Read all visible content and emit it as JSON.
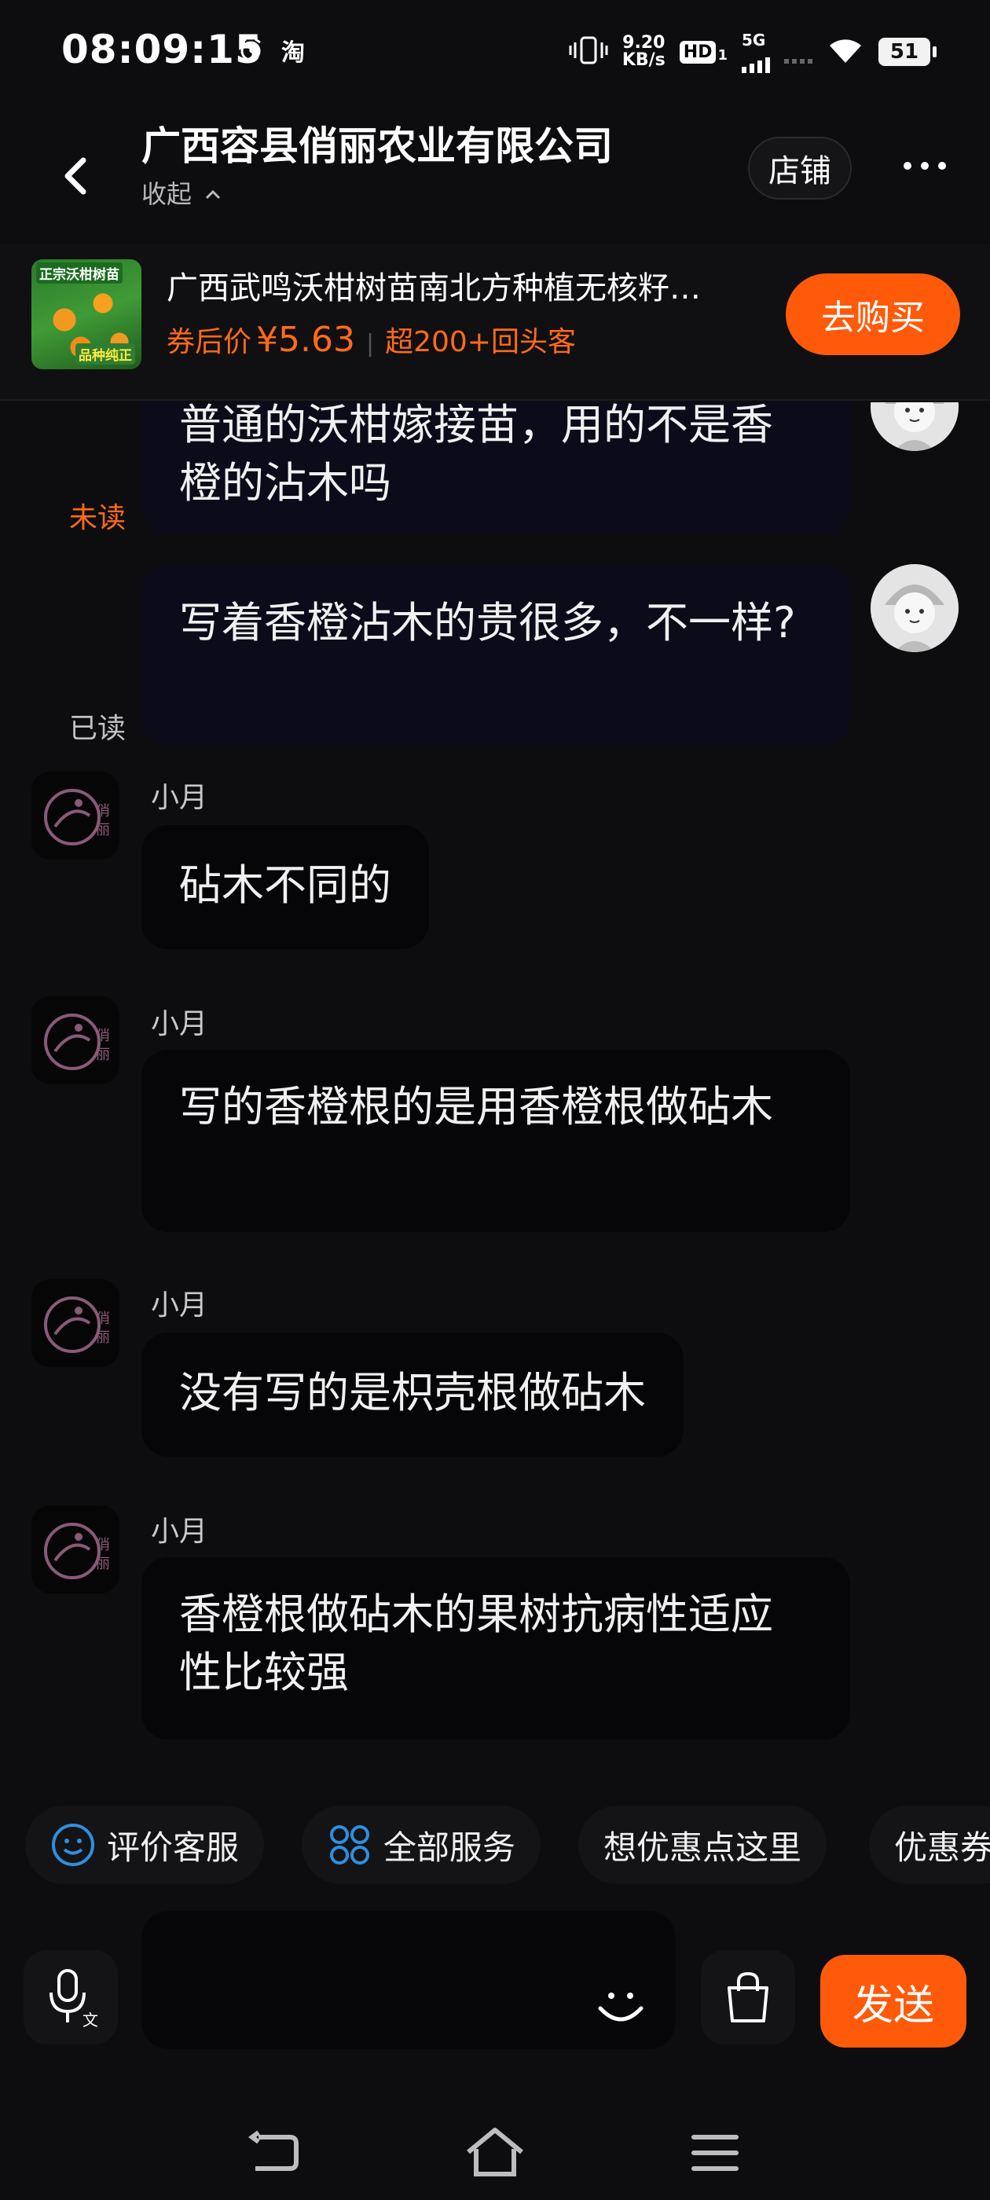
{
  "status_bar": {
    "time": "08:09:15",
    "net_speed_value": "9.20",
    "net_speed_unit": "KB/s",
    "hd_label": "HD",
    "hd_sub": "1",
    "network_type": "5G",
    "battery": "51",
    "app_badge": "淘"
  },
  "header": {
    "shop_name": "广西容县俏丽农业有限公司",
    "collapse_label": "收起",
    "store_button": "店铺"
  },
  "product": {
    "title": "广西武鸣沃柑树苗南北方种植无核籽…",
    "price_label": "券后价",
    "price": "¥5.63",
    "repeat_customers": "超200+回头客",
    "buy_button": "去购买",
    "image_tag_top": "正宗沃柑树苗",
    "image_tag_bottom": "品种纯正"
  },
  "messages": [
    {
      "side": "user",
      "text": "普通的沃柑嫁接苗，用的不是香橙的沾木吗",
      "status": "未读"
    },
    {
      "side": "user",
      "text": "写着香橙沾木的贵很多，不一样?",
      "status": "已读"
    },
    {
      "side": "agent",
      "sender": "小月",
      "text": "砧木不同的"
    },
    {
      "side": "agent",
      "sender": "小月",
      "text": "写的香橙根的是用香橙根做砧木"
    },
    {
      "side": "agent",
      "sender": "小月",
      "text": "没有写的是枳壳根做砧木"
    },
    {
      "side": "agent",
      "sender": "小月",
      "text": "香橙根做砧木的果树抗病性适应性比较强"
    }
  ],
  "quick_actions": [
    "评价客服",
    "全部服务",
    "想优惠点这里",
    "优惠券"
  ],
  "input": {
    "placeholder": "",
    "send_button": "发送"
  },
  "colors": {
    "accent": "#ff5a0a",
    "unread": "#ff6a1a",
    "background": "#0d0d0f"
  }
}
